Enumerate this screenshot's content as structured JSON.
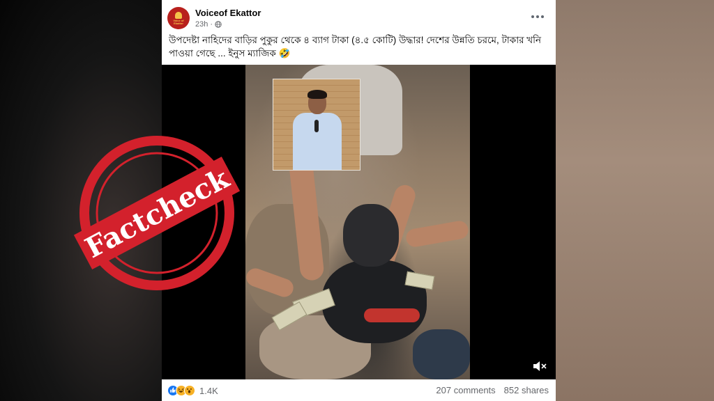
{
  "post": {
    "page_name": "Voiceof Ekattor",
    "avatar_text": [
      "Voice of",
      "Ekattor"
    ],
    "timestamp": "23h",
    "separator": "·",
    "caption": "উপদেষ্টা নাহিদের বাড়ির পুকুর থেকে ৪ ব্যাগ টাকা (৪.৫ কোটি) উদ্ধার! দেশের উন্নতি চরমে, টাকার খনি পাওয়া গেছে ... ইনুস ম্যাজিক 🤣",
    "reactions": {
      "icons": [
        "like-icon",
        "haha-icon",
        "wow-icon"
      ],
      "count": "1.4K"
    },
    "comments": "207 comments",
    "shares": "852 shares"
  },
  "overlay": {
    "stamp_text": "Factcheck",
    "stamp_color": "#d3212c"
  },
  "colors": {
    "secondary_text": "#65676b",
    "primary_text": "#050505",
    "brand_red": "#b8201d"
  }
}
